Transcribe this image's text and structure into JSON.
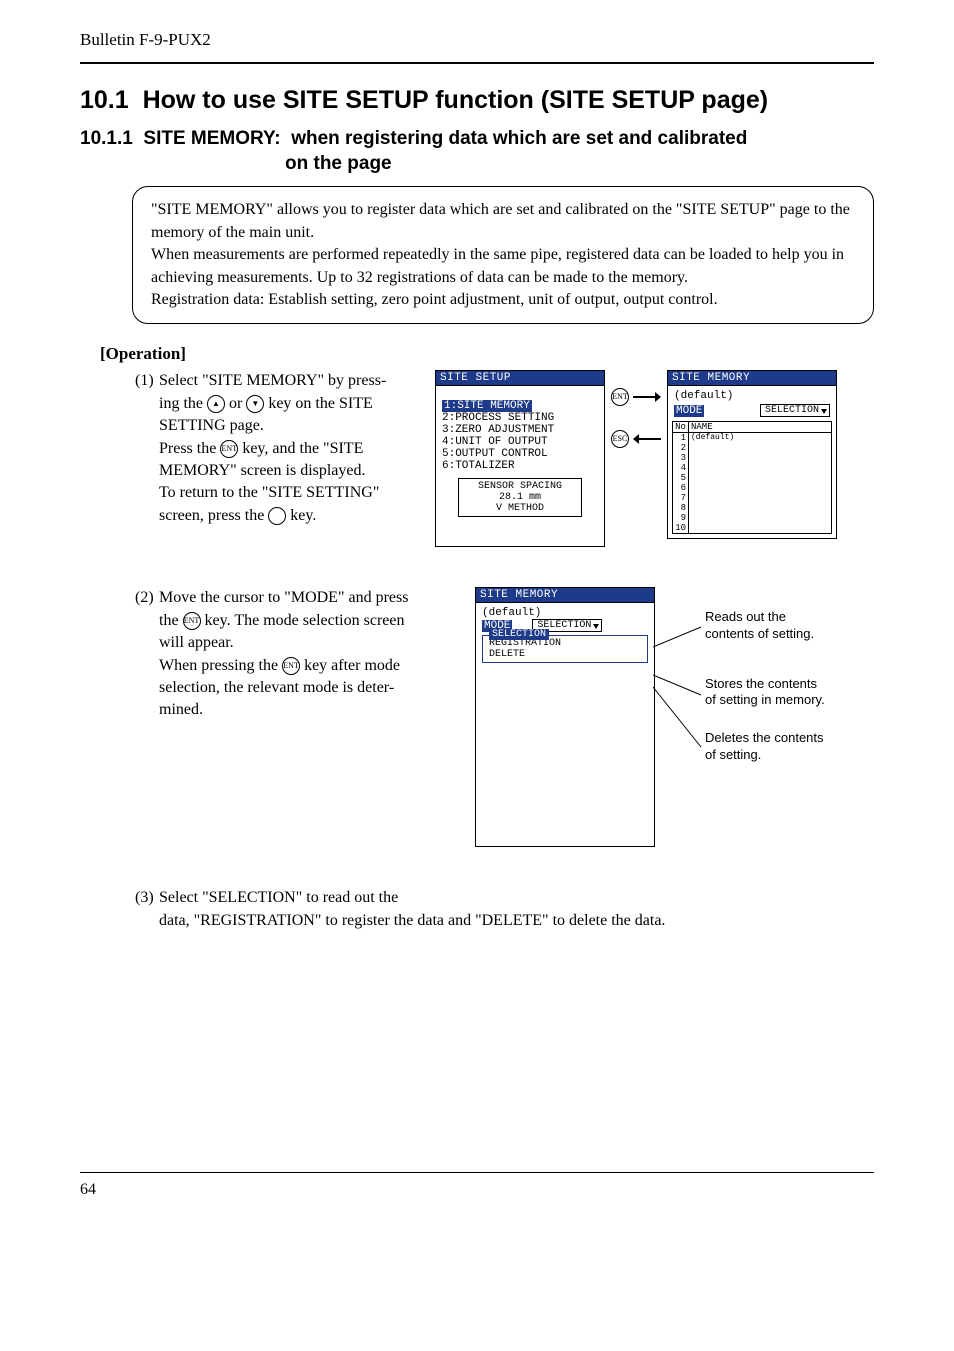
{
  "header": {
    "bulletin": "Bulletin F-9-PUX2"
  },
  "section": {
    "num": "10.1",
    "title": "How to use SITE SETUP function (SITE SETUP page)"
  },
  "subsection": {
    "num": "10.1.1",
    "label": "SITE MEMORY:",
    "cont": "when registering data which are set and calibrated",
    "cont2": "on the page"
  },
  "infobox": {
    "p1": "\"SITE MEMORY\" allows you to register data which are set and calibrated on the \"SITE SETUP\" page to the memory of the main unit.",
    "p2": "When measurements are performed repeatedly in the same pipe, registered data can be loaded to help you in achieving measurements.  Up to 32 registrations of data can be made to the memory.",
    "p3": "Registration data: Establish setting, zero point adjustment, unit of output, output control."
  },
  "operation_heading": "[Operation]",
  "step1": {
    "num": "(1)",
    "l1a": "Select \"SITE MEMORY\" by press-",
    "l1b": "ing the ",
    "l1c": " or ",
    "l1d": " key on the SITE",
    "l2": "SETTING page.",
    "l3a": "Press the ",
    "l3b": " key, and the \"SITE",
    "l4": "MEMORY\" screen is displayed.",
    "l5": "To return to the \"SITE SETTING\"",
    "l6a": "screen, press the ",
    "l6b": " key."
  },
  "lcd_setup": {
    "title": "SITE SETUP",
    "items": [
      "1:SITE MEMORY",
      "2:PROCESS SETTING",
      "3:ZERO ADJUSTMENT",
      "4:UNIT OF OUTPUT",
      "5:OUTPUT CONTROL",
      "6:TOTALIZER"
    ],
    "box": [
      "SENSOR SPACING",
      "28.1 mm",
      "V METHOD"
    ]
  },
  "keys": {
    "ent": "ENT",
    "esc": "ESC",
    "up": "▲",
    "down": "▼"
  },
  "lcd_memory": {
    "title": "SITE MEMORY",
    "default": "(default)",
    "mode": "MODE",
    "sel": "SELECTION",
    "hdr_no": "No",
    "hdr_name": "NAME",
    "row1_val": "(default)",
    "rows": [
      "1",
      "2",
      "3",
      "4",
      "5",
      "6",
      "7",
      "8",
      "9",
      "10"
    ]
  },
  "step2": {
    "num": "(2)",
    "l1": "Move the cursor to \"MODE\" and press",
    "l2a": "the ",
    "l2b": " key.  The mode selection screen",
    "l3": "will appear.",
    "l4a": "When pressing the ",
    "l4b": " key after mode",
    "l5": "selection, the relevant mode is deter-",
    "l6": "mined."
  },
  "lcd_mode": {
    "title": "SITE MEMORY",
    "default": "(default)",
    "mode": "MODE",
    "sel": "SELECTION",
    "menu_label": "SELECTION",
    "opt1": "REGISTRATION",
    "opt2": "DELETE"
  },
  "callouts": {
    "c1a": "Reads out the",
    "c1b": "contents of setting.",
    "c2a": "Stores the contents",
    "c2b": "of setting in memory.",
    "c3a": "Deletes the contents",
    "c3b": "of setting."
  },
  "step3": {
    "num": "(3)",
    "l1": "Select \"SELECTION\" to read out the",
    "l2": "data, \"REGISTRATION\" to register the data and \"DELETE\" to delete the data."
  },
  "page_num": "64"
}
